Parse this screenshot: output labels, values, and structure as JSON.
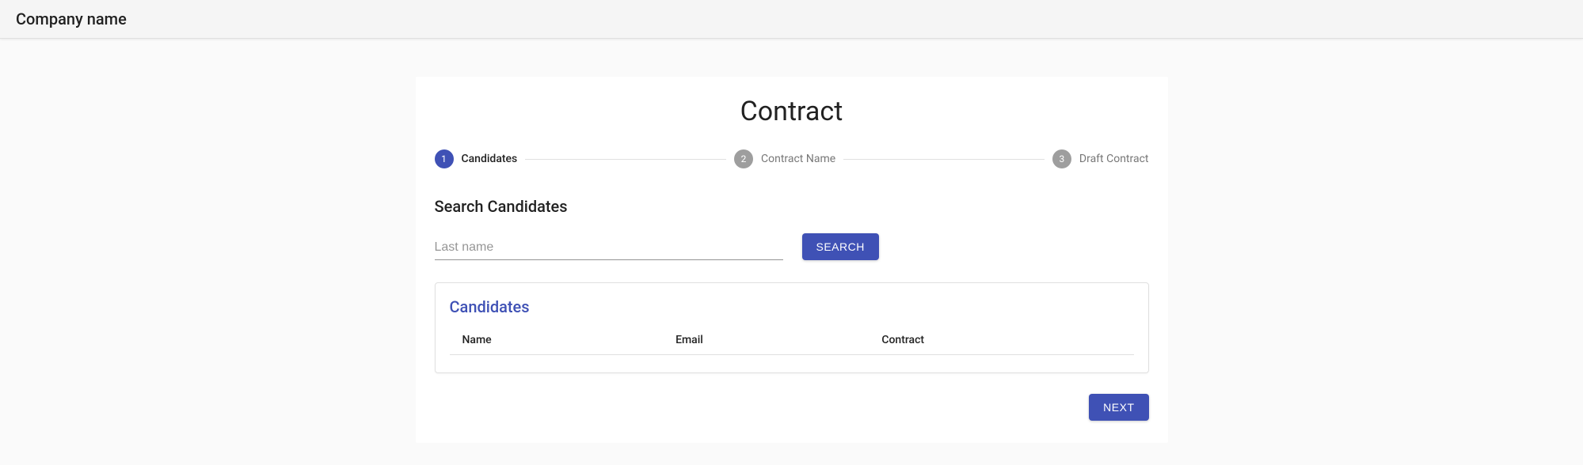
{
  "header": {
    "company_name": "Company name"
  },
  "page": {
    "title": "Contract"
  },
  "stepper": {
    "steps": [
      {
        "num": "1",
        "label": "Candidates",
        "active": true
      },
      {
        "num": "2",
        "label": "Contract Name",
        "active": false
      },
      {
        "num": "3",
        "label": "Draft Contract",
        "active": false
      }
    ]
  },
  "search": {
    "heading": "Search Candidates",
    "lastname_placeholder": "Last name",
    "lastname_value": "",
    "search_button": "Search"
  },
  "results": {
    "title": "Candidates",
    "columns": {
      "name": "Name",
      "email": "Email",
      "contract": "Contract"
    },
    "rows": []
  },
  "actions": {
    "next": "Next"
  },
  "colors": {
    "primary": "#3f51b5"
  }
}
